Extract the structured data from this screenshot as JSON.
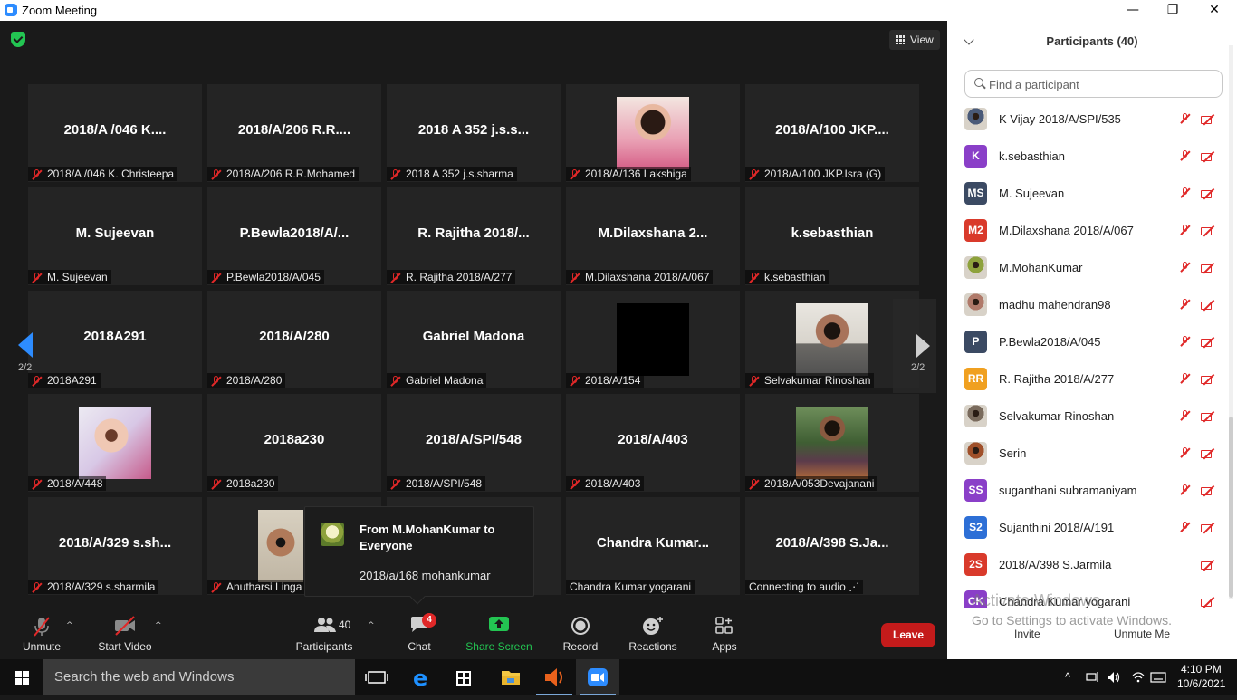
{
  "window": {
    "title": "Zoom Meeting",
    "minimize": "—",
    "maximize": "❐",
    "close": "✕"
  },
  "meeting": {
    "view_label": "View",
    "page_indicator_left": "2/2",
    "page_indicator_right": "2/2",
    "tiles": [
      {
        "big": "2018/A /046 K....",
        "caption": "2018/A /046 K. Christeepa",
        "photo": ""
      },
      {
        "big": "2018/A/206 R.R....",
        "caption": "2018/A/206 R.R.Mohamed",
        "photo": ""
      },
      {
        "big": "2018 A 352 j.s.s...",
        "caption": "2018 A 352 j.s.sharma",
        "photo": ""
      },
      {
        "big": "",
        "caption": "2018/A/136 Lakshiga",
        "photo": "pink"
      },
      {
        "big": "2018/A/100 JKP....",
        "caption": "2018/A/100 JKP.Isra (G)",
        "photo": ""
      },
      {
        "big": "M. Sujeevan",
        "caption": "M. Sujeevan",
        "photo": ""
      },
      {
        "big": "P.Bewla2018/A/...",
        "caption": "P.Bewla2018/A/045",
        "photo": ""
      },
      {
        "big": "R. Rajitha 2018/...",
        "caption": "R. Rajitha 2018/A/277",
        "photo": ""
      },
      {
        "big": "M.Dilaxshana  2...",
        "caption": "M.Dilaxshana 2018/A/067",
        "photo": ""
      },
      {
        "big": "k.sebasthian",
        "caption": "k.sebasthian",
        "photo": ""
      },
      {
        "big": "2018A291",
        "caption": "2018A291",
        "photo": ""
      },
      {
        "big": "2018/A/280",
        "caption": "2018/A/280",
        "photo": ""
      },
      {
        "big": "Gabriel Madona",
        "caption": "Gabriel Madona",
        "photo": ""
      },
      {
        "big": "",
        "caption": "2018/A/154",
        "photo": "black"
      },
      {
        "big": "",
        "caption": "Selvakumar Rinoshan",
        "photo": "man"
      },
      {
        "big": "",
        "caption": "2018/A/448",
        "photo": "child"
      },
      {
        "big": "2018a230",
        "caption": "2018a230",
        "photo": ""
      },
      {
        "big": "2018/A/SPI/548",
        "caption": "2018/A/SPI/548",
        "photo": ""
      },
      {
        "big": "2018/A/403",
        "caption": "2018/A/403",
        "photo": ""
      },
      {
        "big": "",
        "caption": "2018/A/053Devajanani",
        "photo": "green"
      },
      {
        "big": "2018/A/329 s.sh...",
        "caption": "2018/A/329 s.sharmila",
        "photo": ""
      },
      {
        "big": "",
        "caption": "Anutharsi Linga",
        "photo": "woman"
      },
      {
        "big": "",
        "caption": "",
        "photo": ""
      },
      {
        "big": "Chandra  Kumar...",
        "caption": "Chandra Kumar yogarani",
        "photo": ""
      },
      {
        "big": "2018/A/398 S.Ja...",
        "caption": "Connecting to audio ⋰",
        "photo": ""
      }
    ]
  },
  "chat_popup": {
    "from": "From M.MohanKumar to Everyone",
    "message": "2018/a/168 mohankumar"
  },
  "toolbar": {
    "unmute": "Unmute",
    "start_video": "Start Video",
    "participants": "Participants",
    "participants_count": "40",
    "chat": "Chat",
    "chat_badge": "4",
    "share_screen": "Share Screen",
    "record": "Record",
    "reactions": "Reactions",
    "apps": "Apps",
    "leave": "Leave",
    "caret": "^"
  },
  "panel": {
    "title": "Participants (40)",
    "search_placeholder": "Find a participant",
    "participants": [
      {
        "name": "K Vijay 2018/A/SPI/535",
        "initials": "",
        "color": "#4a5a78",
        "photo": true
      },
      {
        "name": "k.sebasthian",
        "initials": "K",
        "color": "#8a3fc8",
        "photo": false
      },
      {
        "name": "M. Sujeevan",
        "initials": "MS",
        "color": "#3b4a63",
        "photo": false
      },
      {
        "name": "M.Dilaxshana 2018/A/067",
        "initials": "M2",
        "color": "#d93a2b",
        "photo": false
      },
      {
        "name": "M.MohanKumar",
        "initials": "",
        "color": "#8ea23c",
        "photo": true
      },
      {
        "name": "madhu mahendran98",
        "initials": "",
        "color": "#b07a6a",
        "photo": true
      },
      {
        "name": "P.Bewla2018/A/045",
        "initials": "P",
        "color": "#3b4a63",
        "photo": false
      },
      {
        "name": "R. Rajitha 2018/A/277",
        "initials": "RR",
        "color": "#f0a020",
        "photo": false
      },
      {
        "name": "Selvakumar Rinoshan",
        "initials": "",
        "color": "#7a6b5d",
        "photo": true
      },
      {
        "name": "Serin",
        "initials": "",
        "color": "#a0502a",
        "photo": true
      },
      {
        "name": "suganthani subramaniyam",
        "initials": "SS",
        "color": "#8a3fc8",
        "photo": false
      },
      {
        "name": "Sujanthini 2018/A/191",
        "initials": "S2",
        "color": "#2d6fd6",
        "photo": false
      },
      {
        "name": "2018/A/398 S.Jarmila",
        "initials": "2S",
        "color": "#d93a2b",
        "photo": false
      },
      {
        "name": "Chandra Kumar yogarani",
        "initials": "CK",
        "color": "#8a3fc8",
        "photo": false
      }
    ],
    "invite": "Invite",
    "unmute_me": "Unmute Me",
    "watermark_title": "Activate Windows",
    "watermark_sub": "Go to Settings to activate Windows."
  },
  "taskbar": {
    "search_placeholder": "Search the web and Windows",
    "time": "4:10 PM",
    "date": "10/6/2021"
  }
}
